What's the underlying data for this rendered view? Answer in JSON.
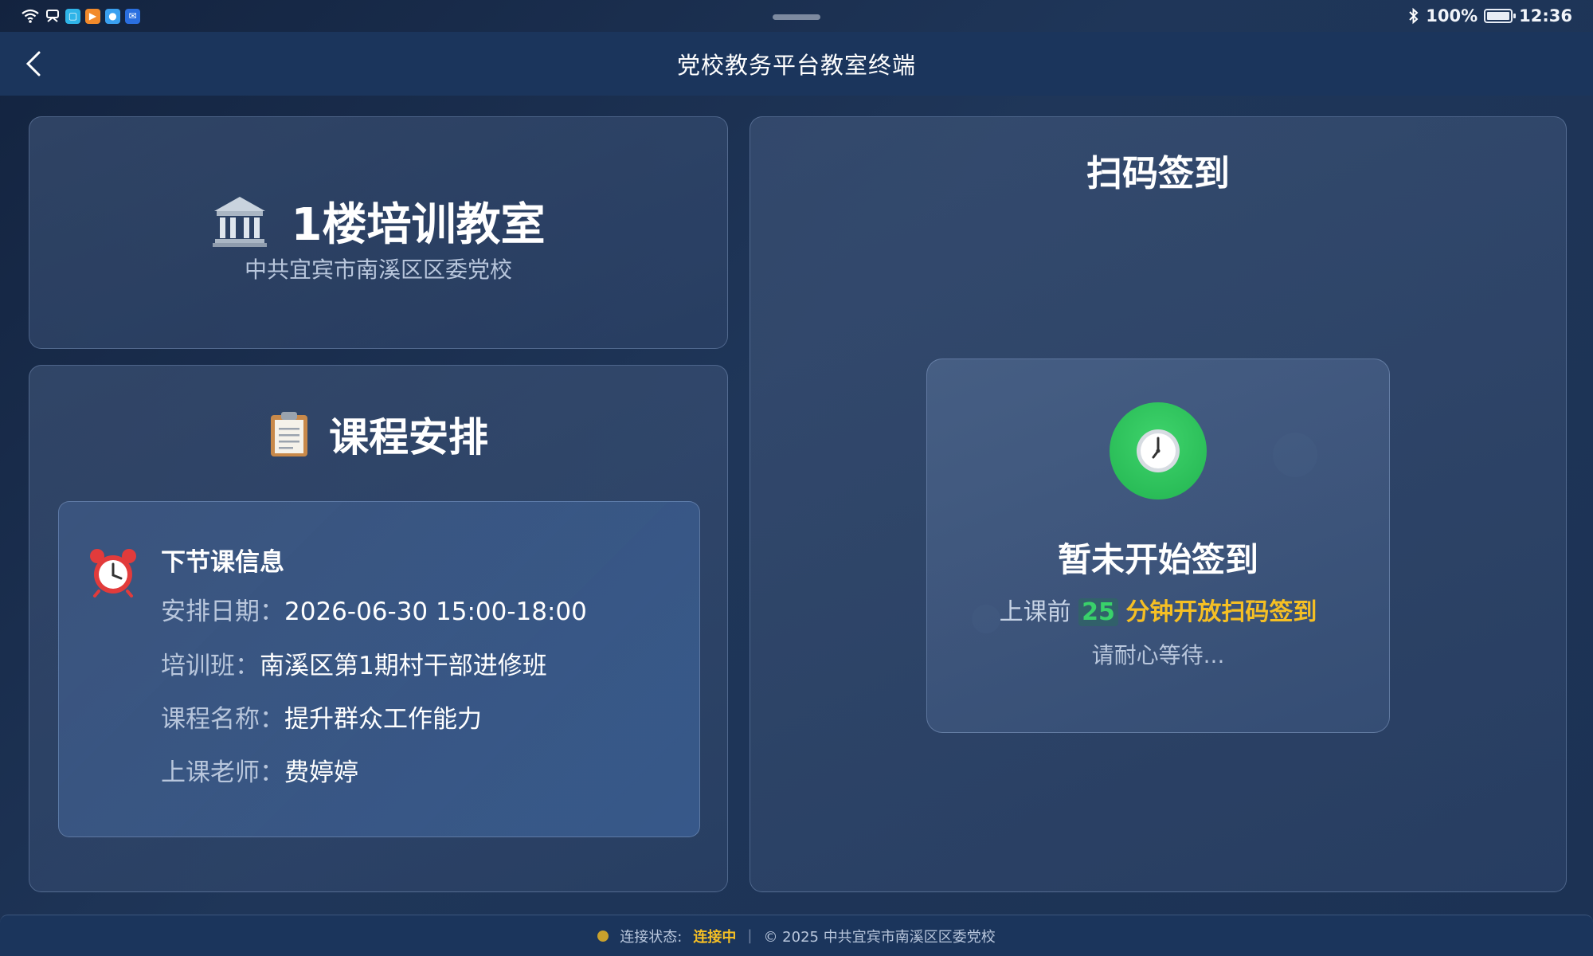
{
  "status_bar": {
    "battery": "100%",
    "time": "12:36"
  },
  "header": {
    "title": "党校教务平台教室终端"
  },
  "room": {
    "name": "1楼培训教室",
    "org": "中共宜宾市南溪区区委党校"
  },
  "course": {
    "title": "课程安排",
    "next": {
      "heading": "下节课信息",
      "date_label": "安排日期：",
      "date_value": "2026-06-30 15:00-18:00",
      "class_label": "培训班：",
      "class_value": "南溪区第1期村干部进修班",
      "name_label": "课程名称：",
      "name_value": "提升群众工作能力",
      "teacher_label": "上课老师：",
      "teacher_value": "费婷婷"
    }
  },
  "signin": {
    "title": "扫码签到",
    "status": "暂未开始签到",
    "msg_prefix": "上课前",
    "minutes": "25",
    "msg_suffix": "分钟开放扫码签到",
    "wait": "请耐心等待..."
  },
  "footer": {
    "conn_label": "连接状态:",
    "conn_value": "连接中",
    "copyright": "© 2025 中共宜宾市南溪区区委党校"
  },
  "colors": {
    "accent_green": "#22b450",
    "accent_yellow": "#f5bf24",
    "header_bg": "#1b355c"
  }
}
